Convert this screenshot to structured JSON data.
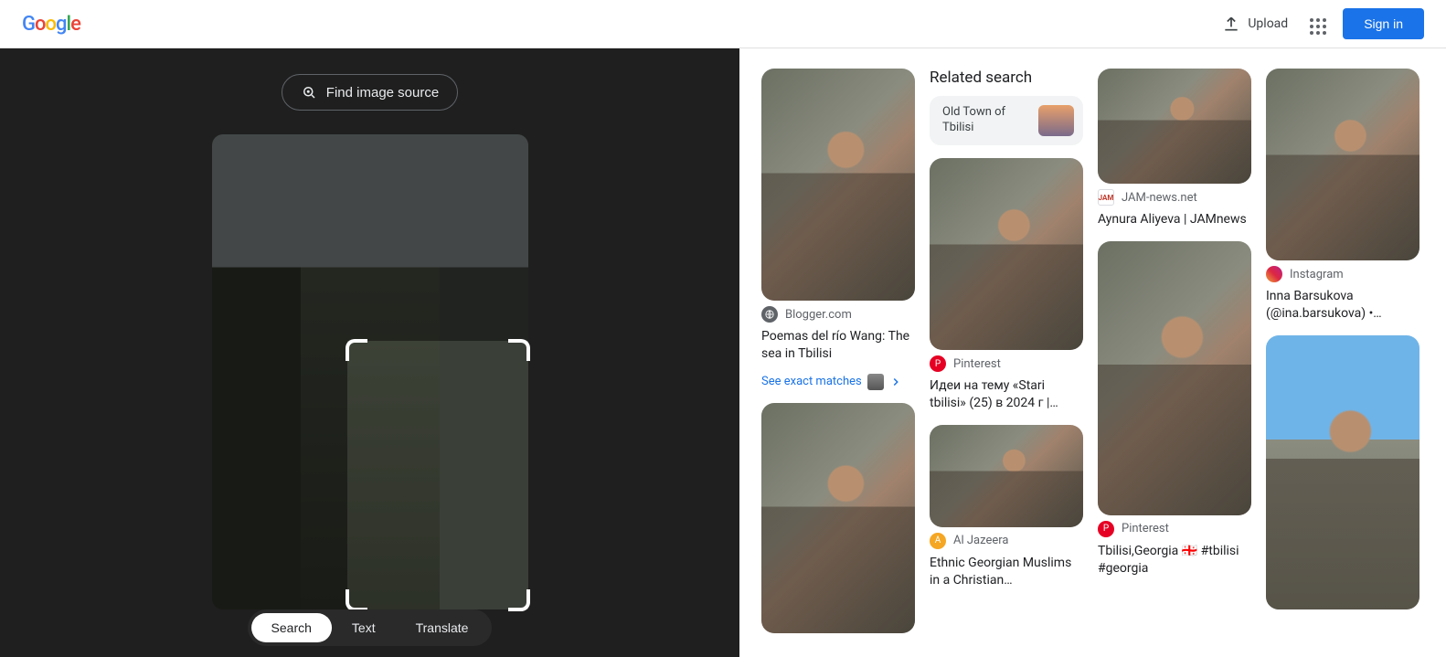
{
  "header": {
    "upload_label": "Upload",
    "signin_label": "Sign in"
  },
  "lens": {
    "find_source_label": "Find image source",
    "modes": {
      "search": "Search",
      "text": "Text",
      "translate": "Translate"
    }
  },
  "related": {
    "heading": "Related search",
    "chip_label": "Old Town of Tbilisi"
  },
  "exact_matches_label": "See exact matches",
  "results": {
    "r1": {
      "source": "Blogger.com",
      "title": "Poemas del río Wang: The sea in Tbilisi"
    },
    "r2": {
      "source": "Pinterest",
      "title": "Идеи на тему «Stari tbilisi» (25) в 2024 г |…"
    },
    "r3": {
      "source": "Al Jazeera",
      "title": "Ethnic Georgian Muslims in a Christian…"
    },
    "r4": {
      "source": "JAM-news.net",
      "title": "Aynura Aliyeva | JAMnews"
    },
    "r5": {
      "source": "Pinterest",
      "title": "Tbilisi,Georgia 🇬🇪 #tbilisi #georgia"
    },
    "r6": {
      "source": "Instagram",
      "title": "Inna Barsukova (@ina.barsukova) •…"
    }
  }
}
